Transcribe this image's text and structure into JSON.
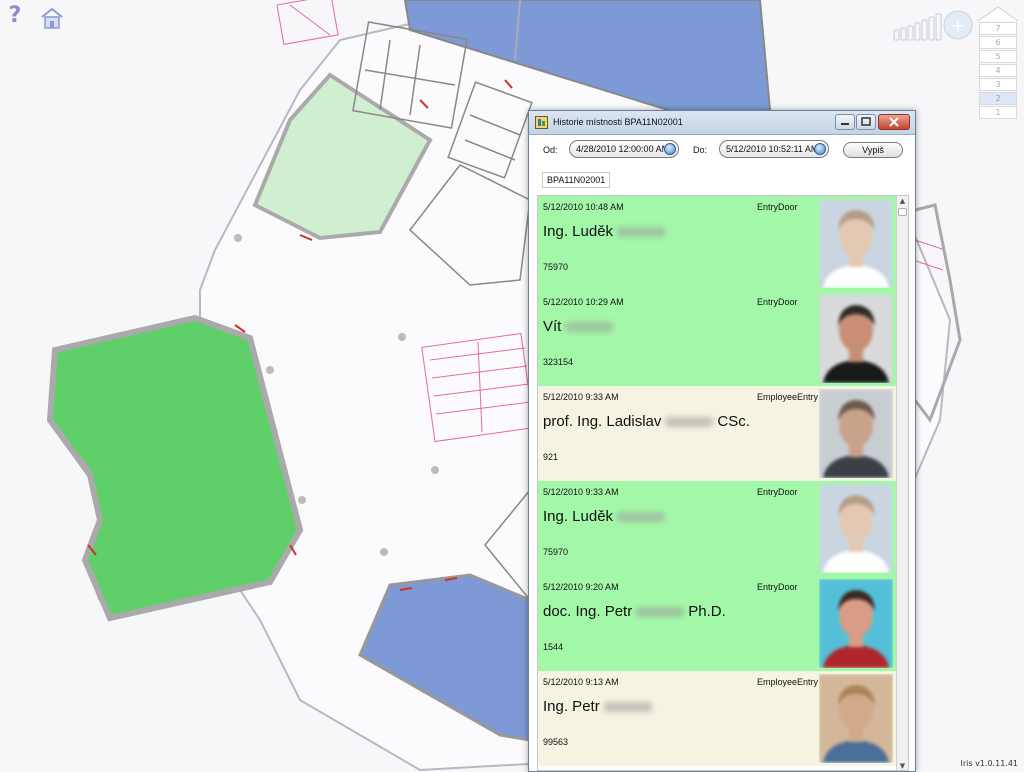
{
  "window": {
    "title": "Historie místnosti BPA11N02001",
    "from_label": "Od:",
    "from_value": "4/28/2010 12:00:00 AM",
    "to_label": "Do:",
    "to_value": "5/12/2010 10:52:11 AM",
    "submit_label": "Vypiš",
    "room_code": "BPA11N02001"
  },
  "colors": {
    "entry_door": "#a3f7a8",
    "employee_entry": "#f5f3e1",
    "room_green": "#5fcf6a",
    "room_light_green": "#d0efd0",
    "room_blue": "#7d9ad6"
  },
  "entries": [
    {
      "time": "5/12/2010 10:48 AM",
      "type": "EntryDoor",
      "name": "Ing. Luděk",
      "suffix": "",
      "number": "75970",
      "kind": "door",
      "photo_bg": "#c9d6e2",
      "skin": "#e3c9b3",
      "hair": "#b69d86",
      "shirt": "#ffffff"
    },
    {
      "time": "5/12/2010 10:29 AM",
      "type": "EntryDoor",
      "name": "Vít",
      "suffix": "",
      "number": "323154",
      "kind": "door",
      "photo_bg": "#d9dadc",
      "skin": "#c88f74",
      "hair": "#2f2a27",
      "shirt": "#1a1a1a"
    },
    {
      "time": "5/12/2010 9:33 AM",
      "type": "EmployeeEntry",
      "name": "prof. Ing. Ladislav",
      "suffix": "CSc.",
      "number": "921",
      "kind": "employee",
      "photo_bg": "#c8cdd2",
      "skin": "#c9a28c",
      "hair": "#6e5a4a",
      "shirt": "#3a3f48"
    },
    {
      "time": "5/12/2010 9:33 AM",
      "type": "EntryDoor",
      "name": "Ing. Luděk",
      "suffix": "",
      "number": "75970",
      "kind": "door",
      "photo_bg": "#c9d6e2",
      "skin": "#e3c9b3",
      "hair": "#b69d86",
      "shirt": "#ffffff"
    },
    {
      "time": "5/12/2010 9:20 AM",
      "type": "EntryDoor",
      "name": "doc. Ing. Petr",
      "suffix": "Ph.D.",
      "number": "1544",
      "kind": "door",
      "photo_bg": "#54c0d8",
      "skin": "#d99c84",
      "hair": "#3c2a22",
      "shirt": "#b0262b"
    },
    {
      "time": "5/12/2010 9:13 AM",
      "type": "EmployeeEntry",
      "name": "Ing. Petr",
      "suffix": "",
      "number": "99563",
      "kind": "employee",
      "photo_bg": "#d4b79a",
      "skin": "#d3a98c",
      "hair": "#a98556",
      "shirt": "#4a6f9a"
    }
  ],
  "floors": [
    "7",
    "6",
    "5",
    "4",
    "3",
    "2",
    "1"
  ],
  "active_floor": "2",
  "version": "Iris v1.0.11.41",
  "icons": {
    "help": "?",
    "home": "home-icon",
    "zoom": "zoom-icon"
  }
}
